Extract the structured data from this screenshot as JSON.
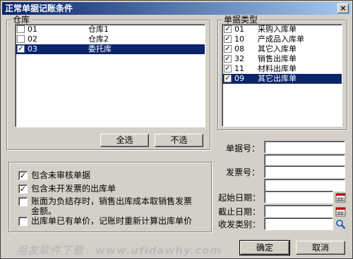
{
  "window": {
    "title": "正常单据记账条件",
    "close_glyph": "×"
  },
  "warehouse": {
    "group_title": "仓库",
    "rows": [
      {
        "checked": false,
        "code": "01",
        "name": "仓库1",
        "selected": false
      },
      {
        "checked": false,
        "code": "02",
        "name": "仓库2",
        "selected": false
      },
      {
        "checked": true,
        "code": "03",
        "name": "委托库",
        "selected": true
      }
    ],
    "select_all_label": "全选",
    "deselect_label": "不选"
  },
  "doc_types": {
    "group_title": "单据类型",
    "rows": [
      {
        "checked": true,
        "code": "01",
        "name": "采购入库单",
        "selected": false
      },
      {
        "checked": true,
        "code": "10",
        "name": "产成品入库单",
        "selected": false
      },
      {
        "checked": true,
        "code": "08",
        "name": "其它入库单",
        "selected": false
      },
      {
        "checked": true,
        "code": "32",
        "name": "销售出库单",
        "selected": false
      },
      {
        "checked": true,
        "code": "11",
        "name": "材料出库单",
        "selected": false
      },
      {
        "checked": true,
        "code": "09",
        "name": "其它出库单",
        "selected": true
      }
    ]
  },
  "options": [
    {
      "checked": true,
      "label": "包含未审核单据"
    },
    {
      "checked": true,
      "label": "包含未开发票的出库单"
    },
    {
      "checked": false,
      "label": "账面为负结存时，销售出库成本取销售发票金额。"
    },
    {
      "checked": false,
      "label": "出库单已有单价，记账时重新计算出库单价"
    }
  ],
  "fields": {
    "doc_no_label": "单据号：",
    "invoice_no_label": "发票号：",
    "start_date_label": "起始日期：",
    "end_date_label": "截止日期：",
    "category_label": "收发类别："
  },
  "buttons": {
    "ok": "确定",
    "cancel": "取消"
  },
  "watermark": "用友软件下载：www.ufidawhy.com"
}
